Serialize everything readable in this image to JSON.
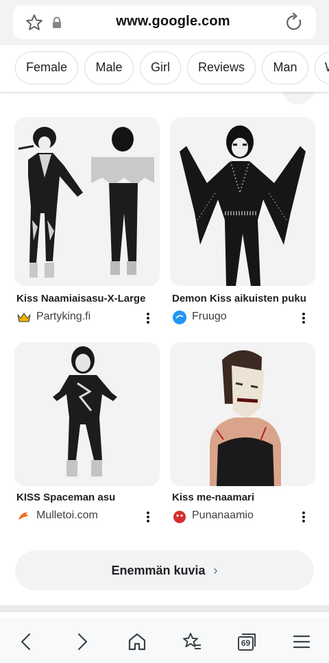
{
  "browser": {
    "url": "www.google.com",
    "icons": [
      "star-outline-icon",
      "lock-icon",
      "reload-icon"
    ]
  },
  "chips": [
    "Female",
    "Male",
    "Girl",
    "Reviews",
    "Man",
    "W"
  ],
  "results": [
    {
      "title": "Kiss Naamiaisasu-X-Large",
      "source": "Partyking.fi",
      "source_icon": "crown-icon"
    },
    {
      "title": "Demon Kiss aikuisten puku",
      "source": "Fruugo",
      "source_icon": "fruugo-icon"
    },
    {
      "title": "KISS Spaceman asu",
      "source": "Mulletoi.com",
      "source_icon": "mulletoi-icon"
    },
    {
      "title": "Kiss me-naamari",
      "source": "Punanaamio",
      "source_icon": "punanaamio-icon"
    }
  ],
  "more_images": {
    "label": "Enemmän kuvia"
  },
  "bottom_nav": {
    "tab_count": "69",
    "icons": [
      "back-icon",
      "forward-icon",
      "home-icon",
      "bookmarks-icon",
      "tabs-icon",
      "menu-icon"
    ]
  }
}
